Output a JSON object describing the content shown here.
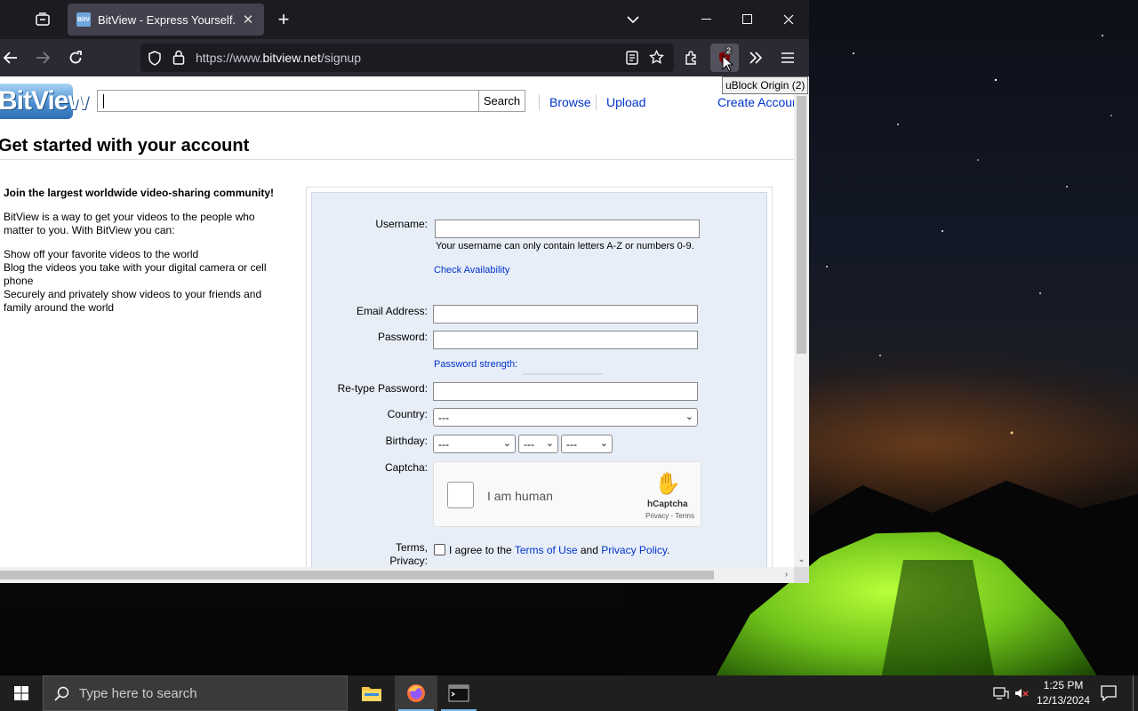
{
  "browser": {
    "tab": {
      "title": "BitView - Express Yourself.",
      "favicon_text": "BitV"
    },
    "url": {
      "prefix": "https://www.",
      "host": "bitview.net",
      "path": "/signup"
    },
    "ublock": {
      "badge": "2",
      "tooltip": "uBlock Origin (2)"
    }
  },
  "site": {
    "logo_text": "BitView",
    "search_button": "Search",
    "nav": {
      "browse": "Browse",
      "upload": "Upload",
      "create_account": "Create Account"
    },
    "page_title": "Get started with your account",
    "intro": {
      "heading": "Join the largest worldwide video-sharing community!",
      "text": "BitView is a way to get your videos to the people who matter to you. With BitView you can:",
      "bullets": [
        "Show off your favorite videos to the world",
        "Blog the videos you take with your digital camera or cell phone",
        "Securely and privately show videos to your friends and family around the world"
      ]
    },
    "form": {
      "username_label": "Username:",
      "username_help": "Your username can only contain letters A-Z or numbers 0-9.",
      "check_availability": "Check Availability",
      "email_label": "Email Address:",
      "password_label": "Password:",
      "password_strength": "Password strength:",
      "retype_label": "Re-type Password:",
      "country_label": "Country:",
      "country_value": "---",
      "birthday_label": "Birthday:",
      "birthday_month": "---",
      "birthday_day": "---",
      "birthday_year": "---",
      "captcha_label": "Captcha:",
      "captcha_text": "I am human",
      "captcha_brand": "hCaptcha",
      "captcha_terms": "Privacy - Terms",
      "terms_label_1": "Terms,",
      "terms_label_2": "Privacy:",
      "terms_prefix": "I agree to the ",
      "terms_of_use": "Terms of Use",
      "terms_and": " and ",
      "privacy_policy": "Privacy Policy",
      "terms_suffix": "."
    }
  },
  "taskbar": {
    "search_placeholder": "Type here to search",
    "time": "1:25 PM",
    "date": "12/13/2024"
  },
  "colors": {
    "link": "#0033cc",
    "form_bg": "#e8eef8",
    "browser_chrome": "#1c1b22",
    "tent_green": "#7cd11f"
  }
}
